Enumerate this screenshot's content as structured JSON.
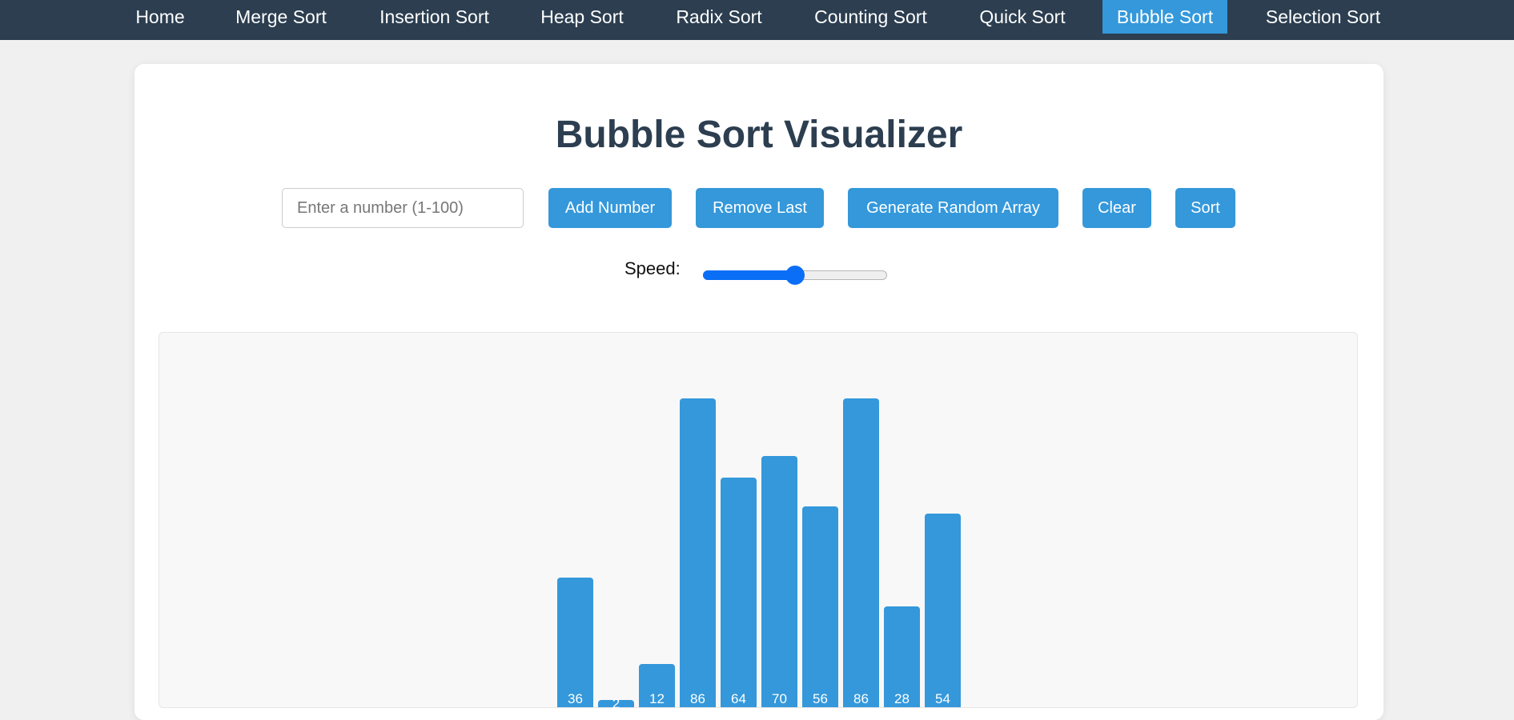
{
  "nav": {
    "items": [
      {
        "label": "Home"
      },
      {
        "label": "Merge Sort"
      },
      {
        "label": "Insertion Sort"
      },
      {
        "label": "Heap Sort"
      },
      {
        "label": "Radix Sort"
      },
      {
        "label": "Counting Sort"
      },
      {
        "label": "Quick Sort"
      },
      {
        "label": "Bubble Sort",
        "active": true
      },
      {
        "label": "Selection Sort"
      }
    ]
  },
  "main": {
    "title": "Bubble Sort Visualizer",
    "input": {
      "placeholder": "Enter a number (1-100)",
      "value": ""
    },
    "buttons": {
      "add": "Add Number",
      "remove": "Remove Last",
      "random": "Generate Random Array",
      "clear": "Clear",
      "sort": "Sort"
    },
    "speed": {
      "label": "Speed:",
      "value": 0.5
    }
  },
  "colors": {
    "nav_bg": "#2c3e50",
    "accent": "#3498db",
    "title": "#2c3e50",
    "slider": "#0b6ef6"
  },
  "chart_data": {
    "type": "bar",
    "values": [
      36,
      2,
      12,
      86,
      64,
      70,
      56,
      86,
      28,
      54
    ]
  }
}
